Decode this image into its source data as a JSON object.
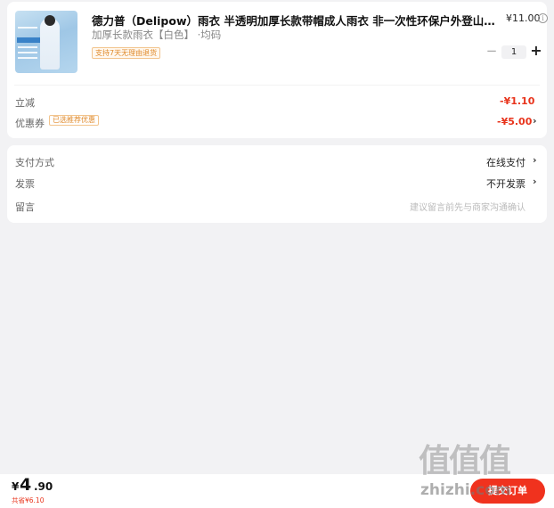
{
  "product": {
    "title": "德力普（Delipow）雨衣 半透明加厚长款带帽成人雨衣 非一次性环保户外登山徒步旅行男女通用",
    "price": "¥11.00",
    "info_icon": "i",
    "spec": "加厚长款雨衣【白色】 ·均码",
    "return_tag": "支持7天无理由退货",
    "quantity": "1",
    "qty_minus": "−",
    "qty_plus": "+"
  },
  "discounts": {
    "instant_label": "立减",
    "instant_value": "-¥1.10",
    "coupon_label": "优惠券",
    "coupon_tag": "已选推荐优惠",
    "coupon_value": "-¥5.00"
  },
  "payment": {
    "method_label": "支付方式",
    "method_value": "在线支付",
    "invoice_label": "发票",
    "invoice_value": "不开发票",
    "note_label": "留言",
    "note_placeholder": "建议留言前先与商家沟通确认"
  },
  "footer": {
    "currency": "¥",
    "total_int": "4",
    "total_dec": ".90",
    "saved": "共省¥6.10",
    "submit_label": "提交订单"
  },
  "watermark": {
    "big": "值值值",
    "small": "zhizhi.com"
  },
  "colors": {
    "accent": "#f0321e",
    "price_red": "#e8341c",
    "tag_orange": "#e08a2b",
    "background": "#f2f2f4"
  },
  "icons": {
    "chevron": "chevron-right-icon",
    "info": "info-icon"
  }
}
